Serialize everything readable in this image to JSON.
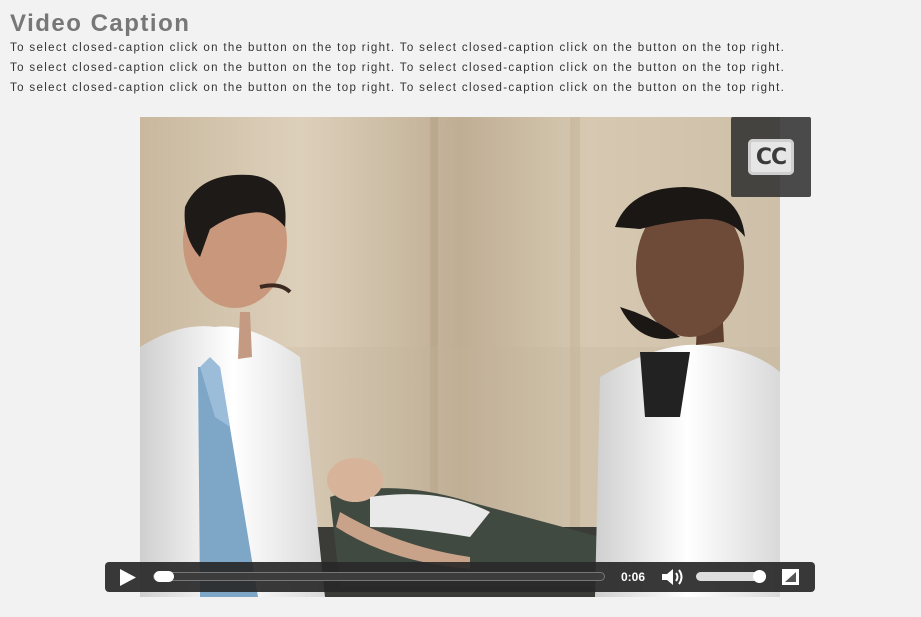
{
  "header": {
    "title": "Video Caption",
    "description_lines": [
      "To select closed-caption click on the button on the top right. To select closed-caption click on the button on the top right.",
      "To select closed-caption click on the button on the top right. To select closed-caption click on the button on the top right.",
      "To select closed-caption click on the button on the top right. To select closed-caption click on the button on the top right."
    ]
  },
  "video": {
    "cc_button": {
      "label": "CC",
      "icon": "closed-caption-icon"
    }
  },
  "controls": {
    "play_icon": "play-icon",
    "current_time": "0:06",
    "seek_progress": 0.0,
    "volume_icon": "volume-icon",
    "volume_level": 1.0,
    "fullscreen_icon": "fullscreen-icon"
  },
  "colors": {
    "page_background": "#f2f2f2",
    "title": "#777777",
    "control_bar": "#282828",
    "cc_panel": "#2d2d2d"
  }
}
